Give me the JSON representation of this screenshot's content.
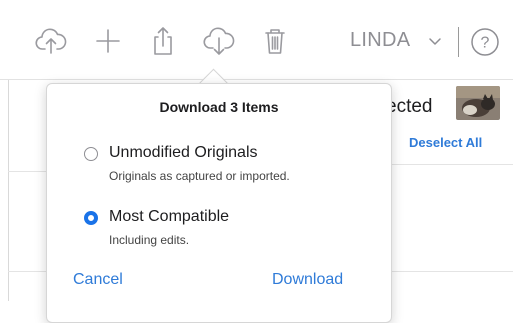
{
  "toolbar": {
    "icons": [
      "upload-icon",
      "add-icon",
      "share-icon",
      "download-icon",
      "trash-icon",
      "chevron-down-icon",
      "help-icon"
    ],
    "account_name": "LINDA",
    "help_glyph": "?"
  },
  "selection": {
    "status_partial": "ected",
    "deselect_all_label": "Deselect All"
  },
  "download_popover": {
    "title": "Download 3 Items",
    "options": [
      {
        "label": "Unmodified Originals",
        "description": "Originals as captured or imported.",
        "selected": false
      },
      {
        "label": "Most Compatible",
        "description": "Including edits.",
        "selected": true
      }
    ],
    "cancel_label": "Cancel",
    "download_label": "Download"
  },
  "colors": {
    "accent": "#1a73e8",
    "link": "#2f7bd8",
    "icon_gray": "#8e8e93"
  }
}
